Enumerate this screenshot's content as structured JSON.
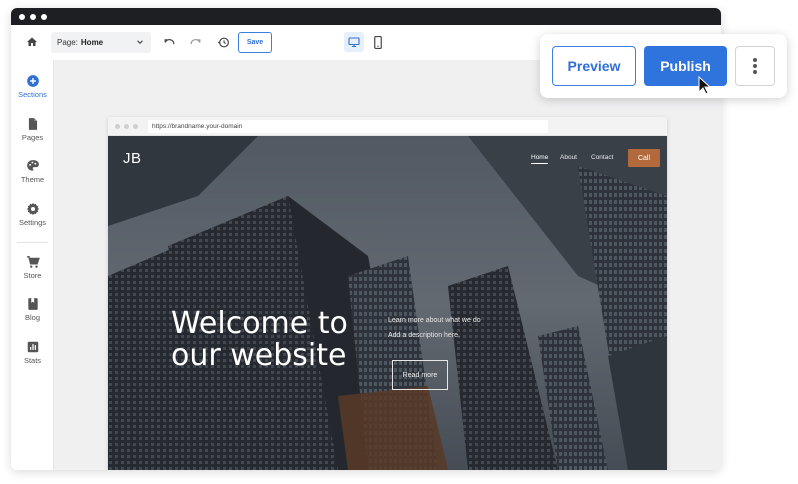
{
  "toolbar": {
    "page_label": "Page:",
    "page_value": "Home",
    "save_label": "Save"
  },
  "sidebar": {
    "items": [
      {
        "label": "Sections",
        "icon": "plus-circle-icon",
        "active": true
      },
      {
        "label": "Pages",
        "icon": "file-icon"
      },
      {
        "label": "Theme",
        "icon": "palette-icon"
      },
      {
        "label": "Settings",
        "icon": "gear-icon"
      },
      {
        "label": "Store",
        "icon": "cart-icon"
      },
      {
        "label": "Blog",
        "icon": "book-icon"
      },
      {
        "label": "Stats",
        "icon": "chart-icon"
      }
    ]
  },
  "browser": {
    "url": "https://brandname.your-domain"
  },
  "site": {
    "logo": "JB",
    "nav": [
      "Home",
      "About",
      "Contact"
    ],
    "call_label": "Call",
    "headline_line1": "Welcome to",
    "headline_line2": "our website",
    "sub_line1": "Learn more about what we do",
    "sub_line2": "Add a description here.",
    "read_more": "Read more"
  },
  "popup": {
    "preview_label": "Preview",
    "publish_label": "Publish"
  },
  "colors": {
    "accent": "#2f73dc",
    "call_button": "#b26a3d",
    "titlebar": "#1e1f22"
  }
}
